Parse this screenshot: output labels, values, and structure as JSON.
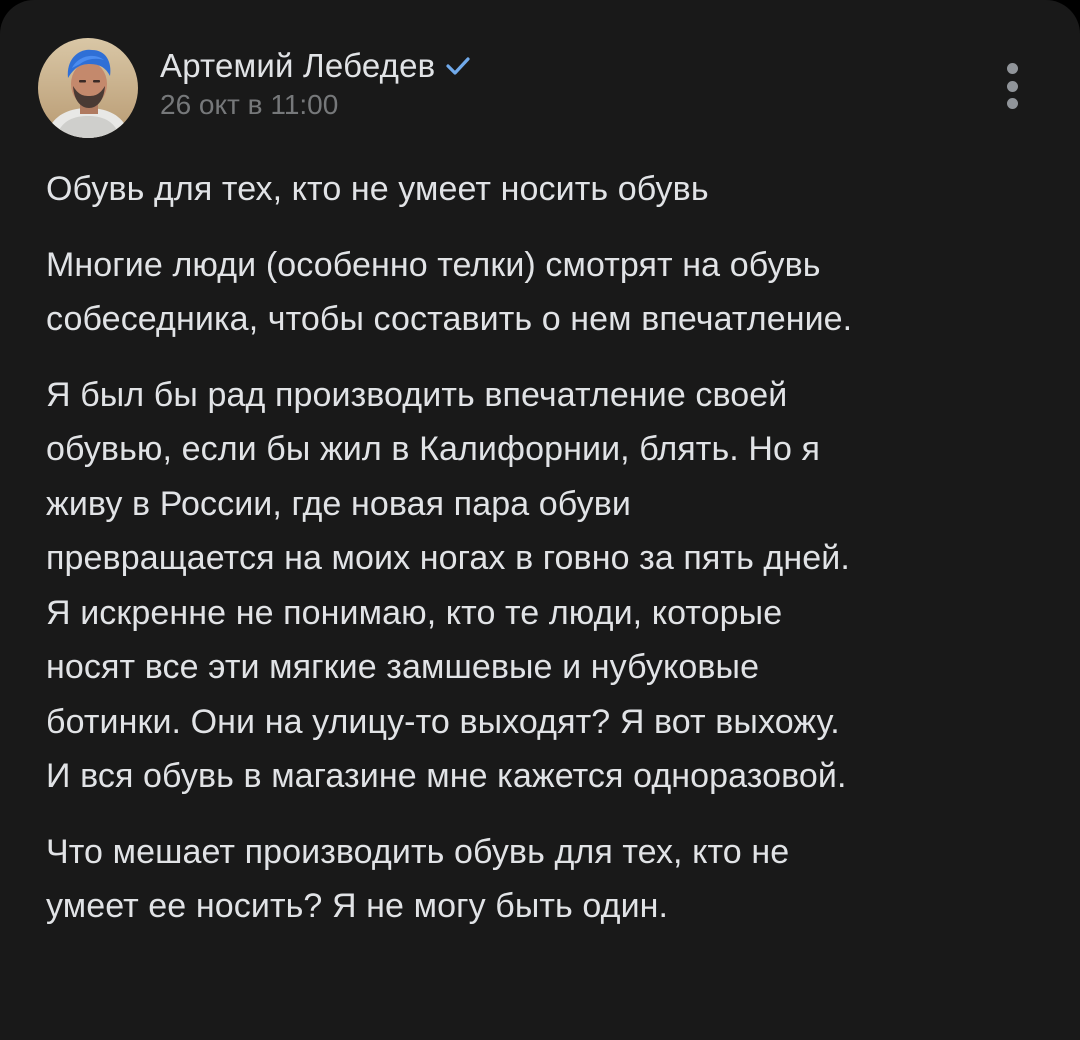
{
  "post": {
    "author_name": "Артемий Лебедев",
    "date": "26 окт в 11:00",
    "paragraphs": [
      "Обувь для тех, кто не умеет носить обувь",
      "Многие люди (особенно телки) смотрят на обувь\nсобеседника, чтобы составить о нем впечатление.",
      "Я был бы рад производить впечатление своей\nобувью, если бы жил в Калифорнии, блять. Но я\nживу в России, где новая пара обуви\nпревращается на моих ногах в говно за пять дней.\nЯ искренне не понимаю, кто те люди, которые\nносят все эти мягкие замшевые и нубуковые\nботинки. Они на улицу-то выходят? Я вот выхожу.\nИ вся обувь в магазине мне кажется одноразовой.",
      "Что мешает производить обувь для тех, кто не\nумеет ее носить? Я не могу быть один."
    ]
  },
  "icons": {
    "verified": "verified-check-icon",
    "menu": "more-vertical-icon"
  },
  "colors": {
    "background": "#191919",
    "text": "#e1e3e6",
    "secondary_text": "#76787a",
    "verified_accent": "#71aaeb"
  }
}
